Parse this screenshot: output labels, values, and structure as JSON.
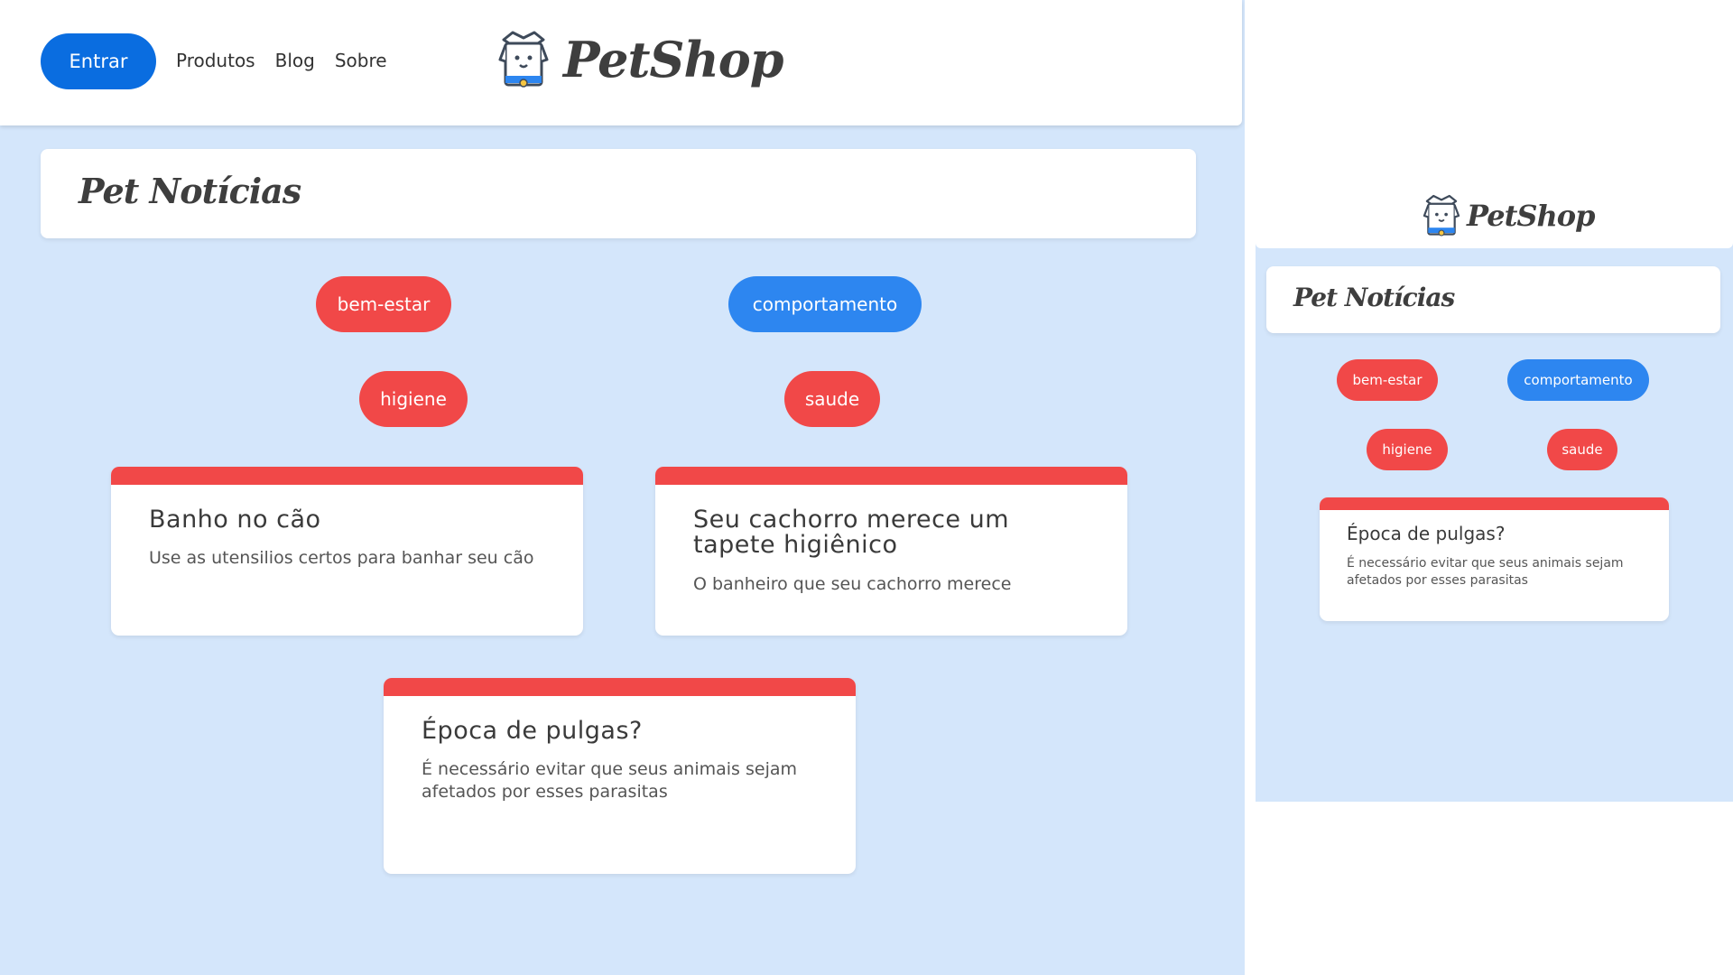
{
  "header": {
    "login_label": "Entrar",
    "nav": [
      "Produtos",
      "Blog",
      "Sobre"
    ],
    "brand": "PetShop"
  },
  "page_title": "Pet Notícias",
  "tags": [
    {
      "label": "bem-estar",
      "color": "#f14848"
    },
    {
      "label": "comportamento",
      "color": "#2d86f0"
    },
    {
      "label": "higiene",
      "color": "#f14848"
    },
    {
      "label": "saude",
      "color": "#f14848"
    }
  ],
  "posts": [
    {
      "title": "Banho no cão",
      "excerpt": "Use as utensilios certos para banhar seu cão"
    },
    {
      "title": "Seu cachorro merece um tapete higiênico",
      "excerpt": "O banheiro que seu cachorro merece"
    },
    {
      "title": "Época de pulgas?",
      "excerpt": "É necessário evitar que seus animais sejam afetados por esses parasitas"
    }
  ],
  "colors": {
    "background": "#d4e6fb",
    "primary": "#0a6de0",
    "accent_red": "#f14848",
    "accent_blue": "#2d86f0"
  }
}
